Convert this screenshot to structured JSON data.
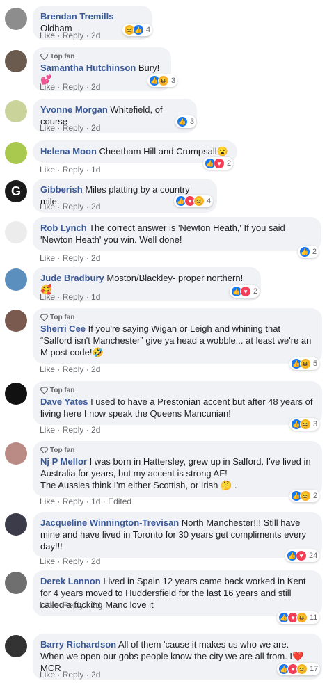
{
  "comments": [
    {
      "name": "Brendan Tremills",
      "text": "Oldham",
      "emoji": "",
      "top_fan": false,
      "time": "2d",
      "edited": "",
      "count": "4",
      "reacts": [
        "haha",
        "like"
      ]
    },
    {
      "name": "Samantha Hutchinson",
      "text": "Bury!",
      "emoji": "💕",
      "top_fan": true,
      "time": "2d",
      "edited": "",
      "count": "3",
      "reacts": [
        "like",
        "haha"
      ]
    },
    {
      "name": "Yvonne Morgan",
      "text": "Whitefield, of course",
      "emoji": "",
      "top_fan": false,
      "time": "2d",
      "edited": "",
      "count": "3",
      "reacts": [
        "like"
      ]
    },
    {
      "name": "Helena Moon",
      "text": "Cheetham Hill and Crumpsall",
      "emoji": "😮",
      "top_fan": false,
      "time": "1d",
      "edited": "",
      "count": "2",
      "reacts": [
        "like",
        "love"
      ]
    },
    {
      "name": "Gibberish",
      "text": "Miles platting by a country mile.",
      "emoji": "",
      "top_fan": false,
      "time": "2d",
      "edited": "",
      "count": "4",
      "reacts": [
        "like",
        "love",
        "haha"
      ]
    },
    {
      "name": "Rob Lynch",
      "text": "The correct answer is 'Newton Heath,' If you said 'Newton Heath' you win. Well done!",
      "emoji": "",
      "top_fan": false,
      "time": "2d",
      "edited": "",
      "count": "2",
      "reacts": [
        "like"
      ]
    },
    {
      "name": "Jude Bradbury",
      "text": "Moston/Blackley- proper northern!",
      "emoji": "🥰",
      "top_fan": false,
      "time": "1d",
      "edited": "",
      "count": "2",
      "reacts": [
        "like",
        "love"
      ]
    },
    {
      "name": "Sherri Cee",
      "text": "If you're saying Wigan or Leigh and whining that “Salford isn't Manchester” give ya head a wobble... at least we're an M post code!",
      "emoji": "🤣",
      "top_fan": true,
      "time": "2d",
      "edited": "",
      "count": "5",
      "reacts": [
        "like",
        "haha"
      ]
    },
    {
      "name": "Dave Yates",
      "text": "I used to have a Prestonian accent but after 48 years of living here I now speak the Queens Mancunian!",
      "emoji": "",
      "top_fan": true,
      "time": "2d",
      "edited": "",
      "count": "3",
      "reacts": [
        "like",
        "haha"
      ]
    },
    {
      "name": "Nj P Mellor",
      "text": "I was born in Hattersley, grew up in Salford. I've lived in Australia for years, but my accent is strong AF!",
      "text2": "The Aussies think I'm either Scottish, or Irish",
      "emoji": "🤔",
      "emoji_tail": ".",
      "top_fan": true,
      "time": "1d",
      "edited": "Edited",
      "count": "2",
      "reacts": [
        "like",
        "haha"
      ]
    },
    {
      "name": "Jacqueline Winnington-Trevisan",
      "text": "North Manchester!!! Still have mine and have lived in Toronto for 30 years get compliments every day!!!",
      "emoji": "",
      "top_fan": false,
      "time": "2d",
      "edited": "",
      "count": "24",
      "reacts": [
        "like",
        "love"
      ]
    },
    {
      "name": "Derek Lannon",
      "text": "Lived in Spain 12 years came back worked in Kent for 4 years moved to Huddersfield for the last 16 years and still called a fucking Manc love it",
      "emoji": "",
      "top_fan": false,
      "time": "2d",
      "edited": "",
      "count": "11",
      "reacts": [
        "like",
        "love",
        "haha"
      ]
    },
    {
      "name": "Barry Richardson",
      "text": "All of them 'cause it makes us who we are. When we open our gobs people know the city we are all from. I",
      "emoji": "❤️",
      "emoji_tail": "MCR",
      "top_fan": false,
      "time": "2d",
      "edited": "",
      "count": "17",
      "reacts": [
        "like",
        "love",
        "haha"
      ]
    }
  ],
  "labels": {
    "like": "Like",
    "reply": "Reply",
    "top_fan": "Top fan",
    "sep": "·"
  },
  "colors": {
    "name": "#385898",
    "bubble": "#f0f2f5",
    "like": "#1877f2",
    "love": "#f33e58",
    "haha": "#f7b125"
  }
}
